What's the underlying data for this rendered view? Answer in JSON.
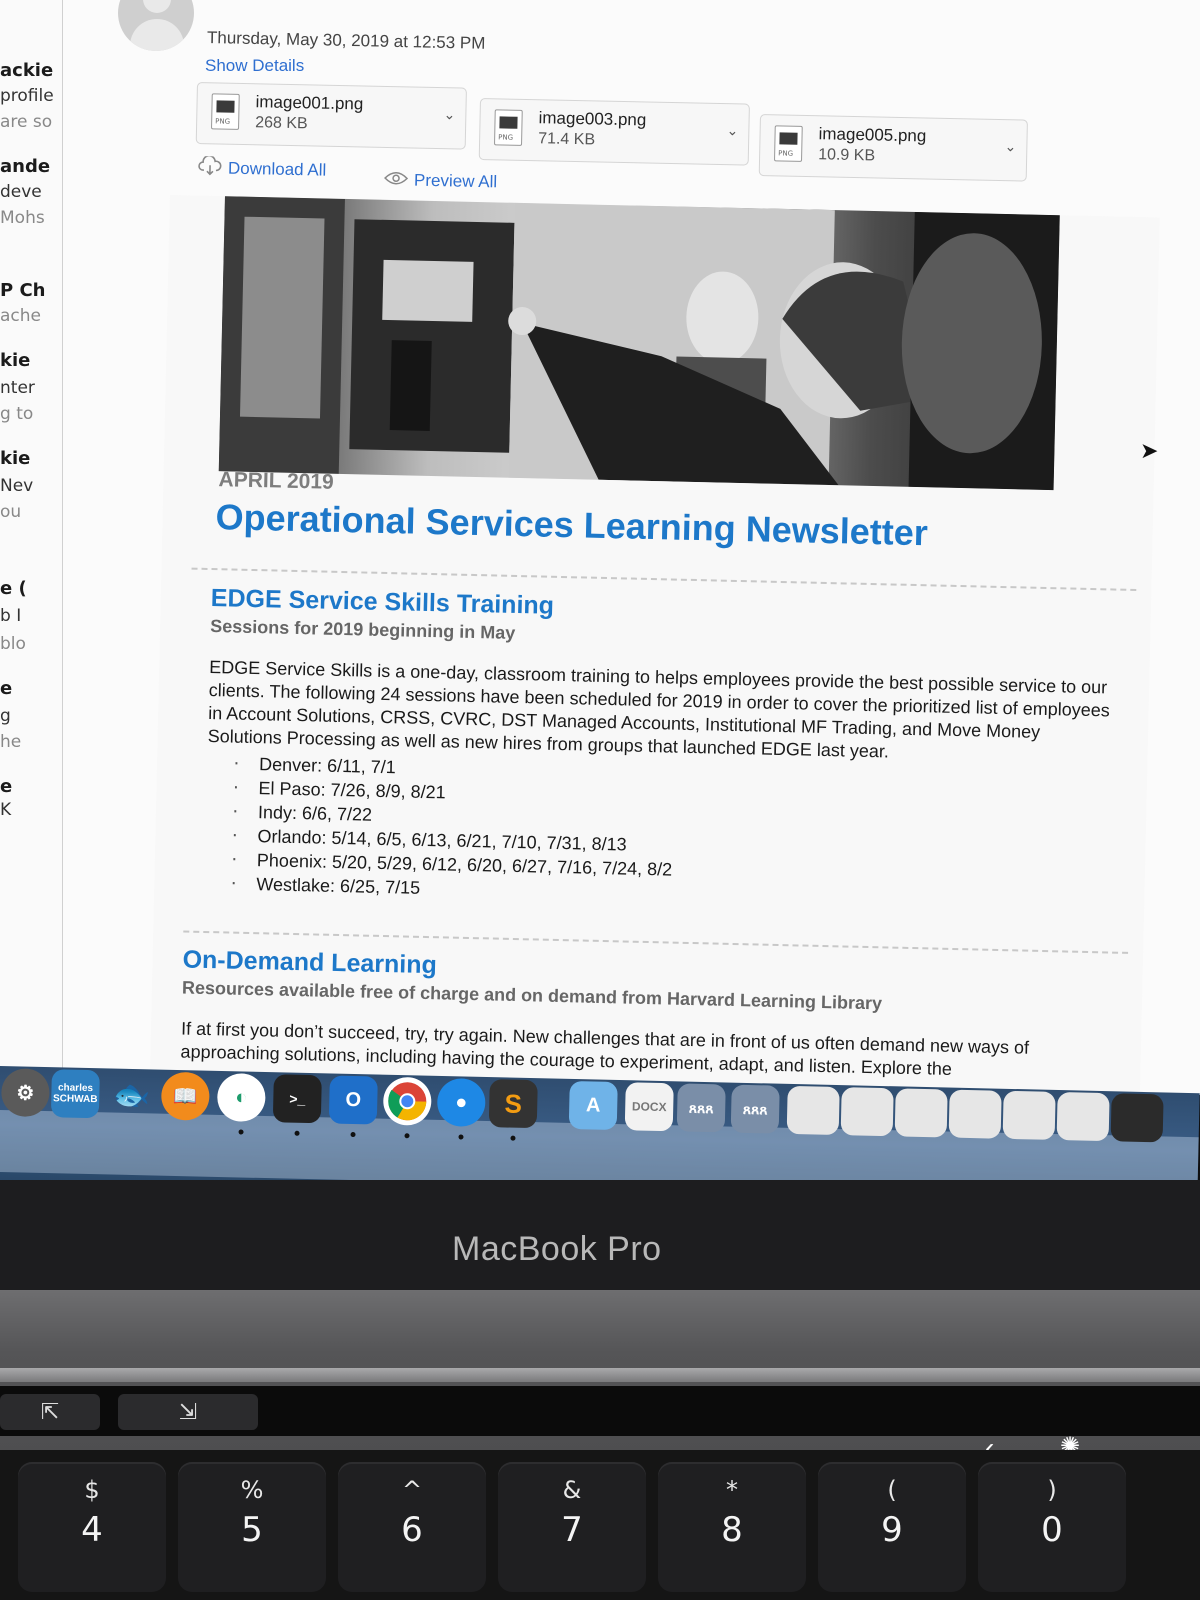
{
  "left_list": [
    {
      "text": "ackie",
      "kind": "name"
    },
    {
      "text": "profile",
      "kind": "sub"
    },
    {
      "text": "are so",
      "kind": "dim"
    },
    {
      "text": "ande",
      "kind": "name"
    },
    {
      "text": "deve",
      "kind": "sub"
    },
    {
      "text": "Mohs",
      "kind": "dim"
    },
    {
      "text": "P Ch",
      "kind": "name"
    },
    {
      "text": "ache",
      "kind": "dim"
    },
    {
      "text": "kie",
      "kind": "name"
    },
    {
      "text": "nter",
      "kind": "sub"
    },
    {
      "text": "g to",
      "kind": "dim"
    },
    {
      "text": "kie",
      "kind": "name"
    },
    {
      "text": "Nev",
      "kind": "sub"
    },
    {
      "text": "ou",
      "kind": "dim"
    },
    {
      "text": "e (",
      "kind": "name"
    },
    {
      "text": "b I",
      "kind": "sub"
    },
    {
      "text": "blo",
      "kind": "dim"
    },
    {
      "text": "e",
      "kind": "name"
    },
    {
      "text": "g",
      "kind": "sub"
    },
    {
      "text": "he",
      "kind": "dim"
    },
    {
      "text": "e",
      "kind": "name"
    },
    {
      "text": "K",
      "kind": "sub"
    }
  ],
  "message": {
    "date": "Thursday, May 30, 2019 at 12:53 PM",
    "show_details": "Show Details",
    "download_all": "Download All",
    "preview_all": "Preview All"
  },
  "attachments": [
    {
      "name": "image001.png",
      "size": "268 KB",
      "type": "PNG"
    },
    {
      "name": "image003.png",
      "size": "71.4 KB",
      "type": "PNG"
    },
    {
      "name": "image005.png",
      "size": "10.9 KB",
      "type": "PNG"
    }
  ],
  "newsletter": {
    "month": "APRIL 2019",
    "title": "Operational Services Learning Newsletter",
    "edge": {
      "heading": "EDGE Service Skills Training",
      "subheading": "Sessions for 2019 beginning in May",
      "paragraph": "EDGE Service Skills is a one-day, classroom training to helps employees provide the best possible service to our clients.  The following 24 sessions have been scheduled for 2019 in order to cover the prioritized list of employees in Account Solutions, CRSS, CVRC, DST Managed Accounts, Institutional MF Trading, and Move Money Solutions Processing as well as new hires from groups that launched EDGE last year.",
      "sessions": [
        "Denver:  6/11, 7/1",
        "El Paso:  7/26, 8/9, 8/21",
        "Indy:  6/6, 7/22",
        "Orlando:  5/14, 6/5, 6/13, 6/21, 7/10, 7/31, 8/13",
        "Phoenix:  5/20, 5/29, 6/12, 6/20, 6/27, 7/16, 7/24, 8/2",
        "Westlake:  6/25, 7/15"
      ]
    },
    "ondemand": {
      "heading": "On-Demand Learning",
      "subheading": "Resources available free of charge and on demand from Harvard Learning Library",
      "paragraph": "If at first you don’t succeed, try, try again. New challenges that are in front of us often demand new ways of approaching solutions, including having the courage to experiment, adapt, and listen. Explore the"
    }
  },
  "dock": {
    "charles_schwab": "charles SCHWAB",
    "icons": [
      "system-preferences-icon",
      "charles-schwab-icon",
      "fish-icon",
      "books-icon",
      "app-icon",
      "terminal-icon",
      "outlook-icon",
      "chrome-icon",
      "maps-pin-icon",
      "sublime-text-icon",
      "applications-folder-icon",
      "document-icon",
      "people-icon",
      "people-icon-2"
    ]
  },
  "laptop": {
    "brand": "MacBook Pro",
    "keys": [
      {
        "top": "$",
        "bottom": "4"
      },
      {
        "top": "%",
        "bottom": "5"
      },
      {
        "top": "^",
        "bottom": "6"
      },
      {
        "top": "&",
        "bottom": "7"
      },
      {
        "top": "*",
        "bottom": "8"
      },
      {
        "top": "(",
        "bottom": "9"
      },
      {
        "top": ")",
        "bottom": "0"
      }
    ]
  },
  "colors": {
    "link_blue": "#2f6fd0",
    "heading_blue": "#1d78c9",
    "dock_blue": "#3a5d86"
  }
}
